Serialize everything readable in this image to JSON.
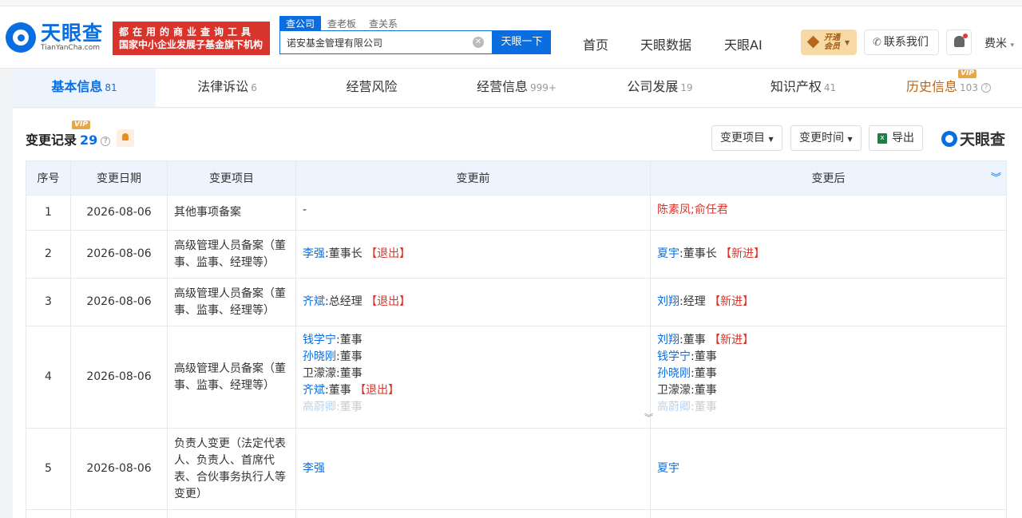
{
  "header": {
    "logo_cn": "天眼查",
    "logo_en": "TianYanCha.com",
    "slogan_line1": "都在用的商业查询工具",
    "slogan_line2": "国家中小企业发展子基金旗下机构",
    "search_tabs": [
      "查公司",
      "查老板",
      "查关系"
    ],
    "search_value": "诺安基金管理有限公司",
    "search_button": "天眼一下",
    "nav": [
      "首页",
      "天眼数据",
      "天眼AI"
    ],
    "vip_button": "开通会员",
    "contact": "联系我们",
    "user": "费米"
  },
  "tabs": [
    {
      "label": "基本信息",
      "count": "81"
    },
    {
      "label": "法律诉讼",
      "count": "6"
    },
    {
      "label": "经营风险",
      "count": ""
    },
    {
      "label": "经营信息",
      "count": "999+"
    },
    {
      "label": "公司发展",
      "count": "19"
    },
    {
      "label": "知识产权",
      "count": "41"
    },
    {
      "label": "历史信息",
      "count": "103"
    }
  ],
  "vip_label": "VIP",
  "section": {
    "title": "变更记录",
    "count": "29",
    "filter_item": "变更项目",
    "filter_time": "变更时间",
    "export": "导出",
    "brand": "天眼查"
  },
  "table": {
    "headers": [
      "序号",
      "变更日期",
      "变更项目",
      "变更前",
      "变更后"
    ],
    "rows": [
      {
        "no": "1",
        "date": "2026-08-06",
        "item": "其他事项备案",
        "before": "-",
        "after": "陈素凤;俞任君"
      },
      {
        "no": "2",
        "date": "2026-08-06",
        "item": "高级管理人员备案（董事、监事、经理等）",
        "before_name": "李强",
        "before_role": ":董事长",
        "before_tag": "【退出】",
        "after_name": "夏宇",
        "after_role": ":董事长",
        "after_tag": "【新进】"
      },
      {
        "no": "3",
        "date": "2026-08-06",
        "item": "高级管理人员备案（董事、监事、经理等）",
        "before_name": "齐斌",
        "before_role": ":总经理",
        "before_tag": "【退出】",
        "after_name": "刘翔",
        "after_role": ":经理",
        "after_tag": "【新进】"
      },
      {
        "no": "4",
        "date": "2026-08-06",
        "item": "高级管理人员备案（董事、监事、经理等）",
        "before": [
          {
            "name": "钱学宁",
            "role": ":董事",
            "tag": ""
          },
          {
            "name": "孙晓刚",
            "role": ":董事",
            "tag": ""
          },
          {
            "name": "卫濛濛",
            "role": ":董事",
            "tag": ""
          },
          {
            "name": "齐斌",
            "role": ":董事",
            "tag": "【退出】"
          },
          {
            "name": "高蔚卿",
            "role": ":董事",
            "tag": ""
          }
        ],
        "after": [
          {
            "name": "刘翔",
            "role": ":董事",
            "tag": "【新进】"
          },
          {
            "name": "钱学宁",
            "role": ":董事",
            "tag": ""
          },
          {
            "name": "孙晓刚",
            "role": ":董事",
            "tag": ""
          },
          {
            "name": "卫濛濛",
            "role": ":董事",
            "tag": ""
          },
          {
            "name": "高蔚卿",
            "role": ":董事",
            "tag": ""
          }
        ]
      },
      {
        "no": "5",
        "date": "2026-08-06",
        "item": "负责人变更（法定代表人、负责人、首席代表、合伙事务执行人等变更）",
        "before": "李强",
        "after": "夏宇"
      }
    ]
  }
}
